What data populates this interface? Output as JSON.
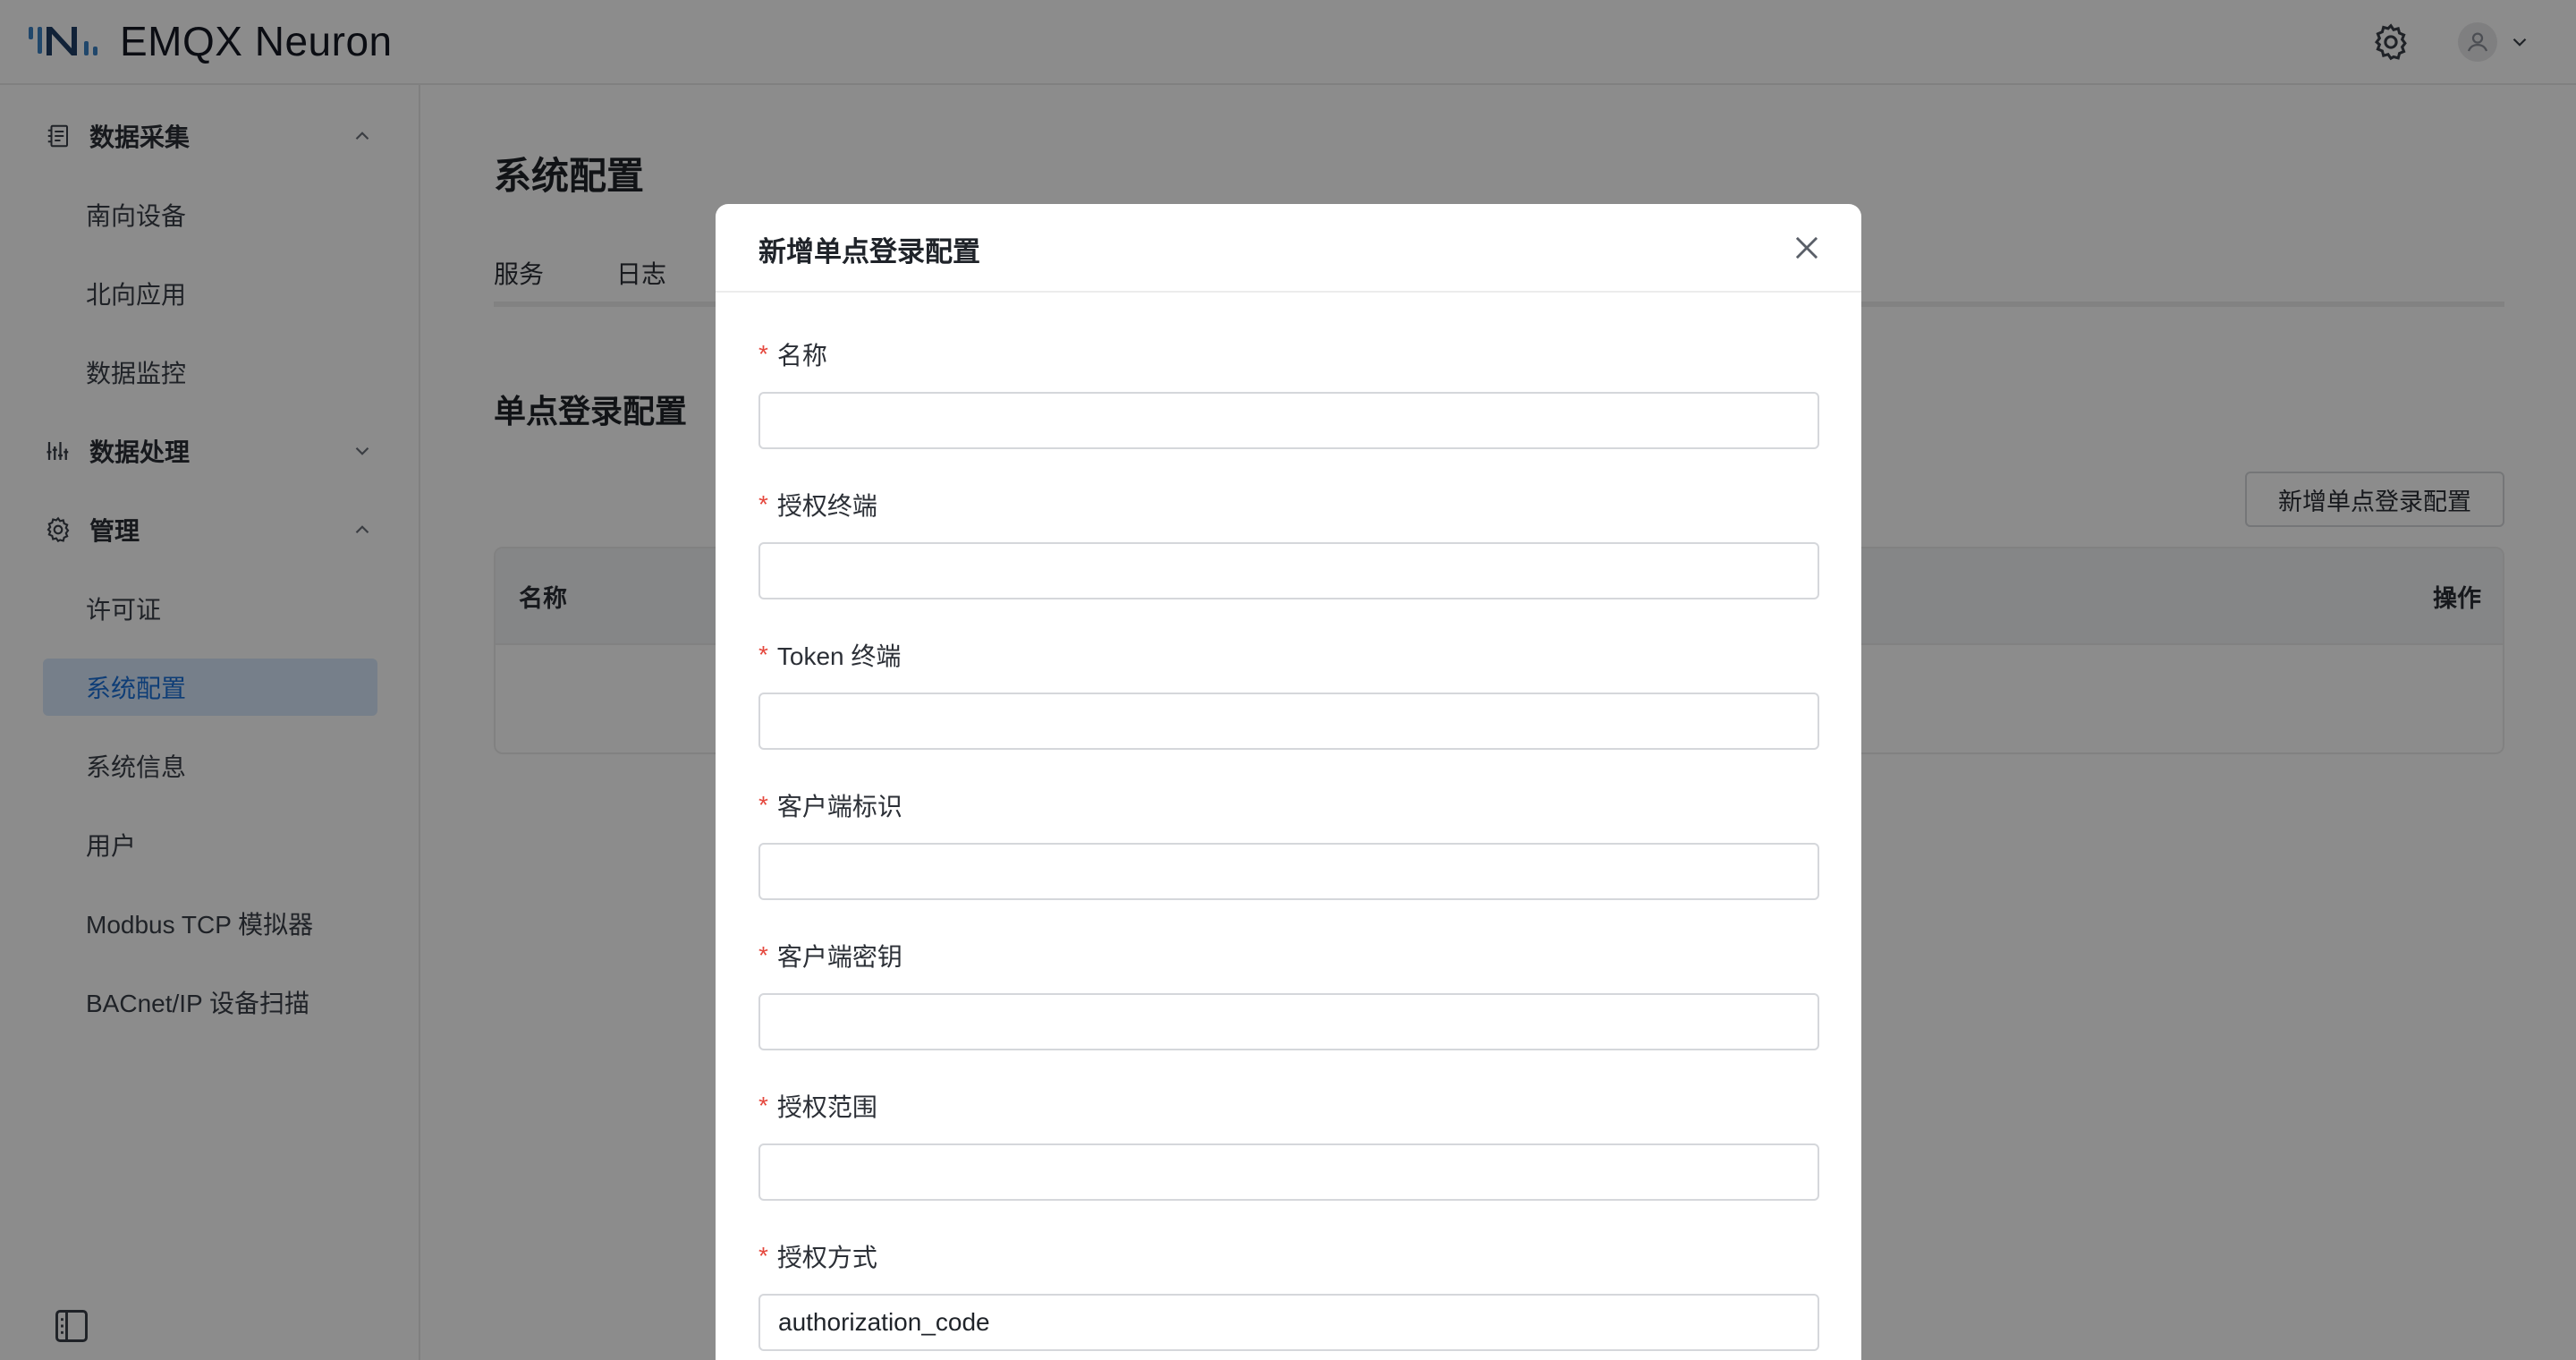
{
  "app": {
    "title": "EMQX Neuron"
  },
  "header": {
    "settings_icon": "gear-icon",
    "user_icon": "user-avatar-icon",
    "user_menu_icon": "chevron-down-icon"
  },
  "sidebar": {
    "groups": [
      {
        "label": "数据采集",
        "icon": "data-collection-icon",
        "expanded": true,
        "items": [
          {
            "label": "南向设备"
          },
          {
            "label": "北向应用"
          },
          {
            "label": "数据监控"
          }
        ]
      },
      {
        "label": "数据处理",
        "icon": "data-processing-icon",
        "expanded": false,
        "items": []
      },
      {
        "label": "管理",
        "icon": "gear-icon",
        "expanded": true,
        "items": [
          {
            "label": "许可证"
          },
          {
            "label": "系统配置",
            "active": true
          },
          {
            "label": "系统信息"
          },
          {
            "label": "用户"
          },
          {
            "label": "Modbus TCP 模拟器"
          },
          {
            "label": "BACnet/IP 设备扫描"
          }
        ]
      }
    ],
    "collapse_icon": "sidebar-collapse-icon"
  },
  "main": {
    "page_title": "系统配置",
    "tabs": [
      {
        "label": "服务"
      },
      {
        "label": "日志"
      }
    ],
    "section_title": "单点登录配置",
    "add_button": "新增单点登录配置",
    "table": {
      "columns": [
        {
          "label": "名称"
        },
        {
          "label": "操作"
        }
      ],
      "rows": []
    }
  },
  "modal": {
    "title": "新增单点登录配置",
    "close_icon": "close-icon",
    "fields": [
      {
        "label": "名称",
        "required": true,
        "value": "",
        "placeholder": ""
      },
      {
        "label": "授权终端",
        "required": true,
        "value": "",
        "placeholder": ""
      },
      {
        "label": "Token 终端",
        "required": true,
        "value": "",
        "placeholder": ""
      },
      {
        "label": "客户端标识",
        "required": true,
        "value": "",
        "placeholder": ""
      },
      {
        "label": "客户端密钥",
        "required": true,
        "value": "",
        "placeholder": ""
      },
      {
        "label": "授权范围",
        "required": true,
        "value": "",
        "placeholder": ""
      },
      {
        "label": "授权方式",
        "required": true,
        "value": "authorization_code",
        "placeholder": ""
      }
    ],
    "required_mark": "*"
  },
  "colors": {
    "accent": "#1b6fd8",
    "active_bg": "#d7e8fb",
    "required": "#e5483e",
    "logo": "#3b82c4"
  }
}
